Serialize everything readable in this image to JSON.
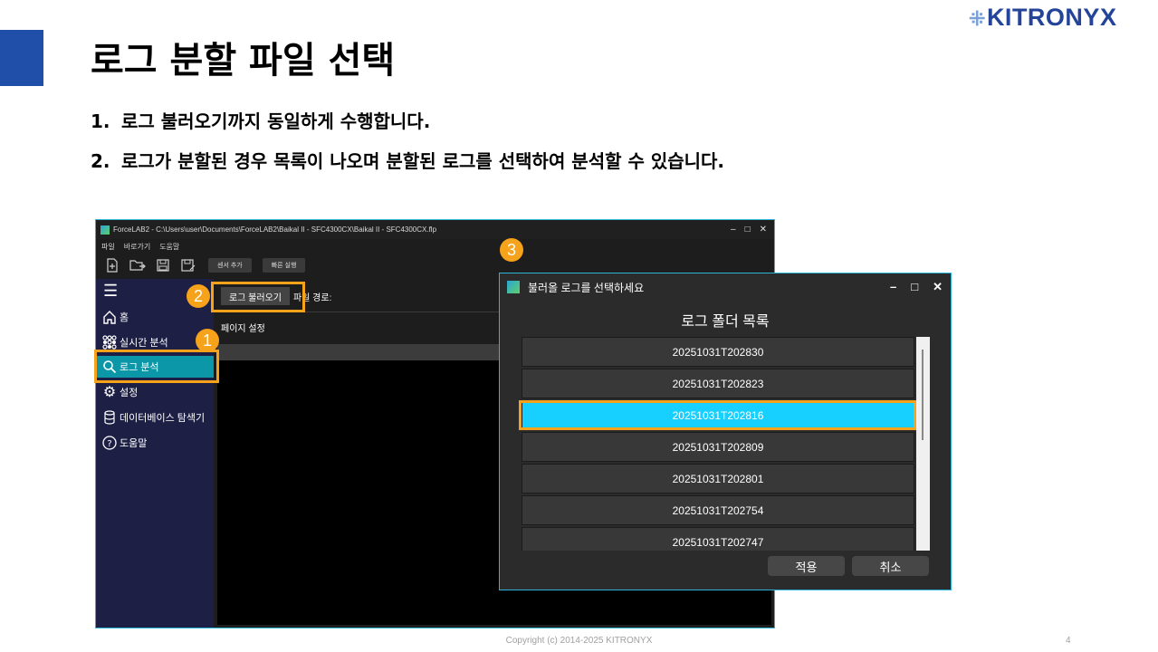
{
  "slide": {
    "title": "로그 분할 파일 선택",
    "logo_text": "KITRONYX",
    "bullets": [
      {
        "num": "1.",
        "text": "로그 불러오기까지 동일하게 수행합니다."
      },
      {
        "num": "2.",
        "text": "로그가 분할된 경우 목록이 나오며 분할된 로그를 선택하여 분석할 수 있습니다."
      }
    ],
    "footer": "Copyright (c) 2014-2025 KITRONYX",
    "page_number": "4"
  },
  "app": {
    "title": "ForceLAB2 - C:\\Users\\user\\Documents\\ForceLAB2\\Baikal II - SFC4300CX\\Baikal II - SFC4300CX.flp",
    "window_controls": [
      "–",
      "□",
      "✕"
    ],
    "menu": [
      "파일",
      "바로가기",
      "도움말"
    ],
    "toolbar": {
      "add_sensor": "센서 추가",
      "quick_run": "빠른 실행"
    },
    "sidebar": [
      {
        "label": "홈",
        "icon": "home-icon"
      },
      {
        "label": "실시간 분석",
        "icon": "grid-icon"
      },
      {
        "label": "로그 분석",
        "icon": "search-icon"
      },
      {
        "label": "설정",
        "icon": "gear-icon"
      },
      {
        "label": "데이터베이스 탐색기",
        "icon": "database-icon"
      },
      {
        "label": "도움말",
        "icon": "help-icon"
      }
    ],
    "load_log_button": "로그 불러오기",
    "file_path_label": "파일 경로:",
    "page_settings": "페이지 설정"
  },
  "dialog": {
    "title": "불러올 로그를 선택하세요",
    "controls": [
      "–",
      "□",
      "✕"
    ],
    "heading": "로그 폴더 목록",
    "items": [
      "20251031T202830",
      "20251031T202823",
      "20251031T202816",
      "20251031T202809",
      "20251031T202801",
      "20251031T202754",
      "20251031T202747"
    ],
    "selected": "20251031T202816",
    "apply": "적용",
    "cancel": "취소"
  },
  "badges": [
    "1",
    "2",
    "3"
  ],
  "colors": {
    "accent_blue": "#1f4fa8",
    "highlight_orange": "#f6a21a",
    "selected_cyan": "#17d0ff",
    "sidebar_active": "#0c97a8",
    "sidebar_bg": "#1d1f45"
  }
}
